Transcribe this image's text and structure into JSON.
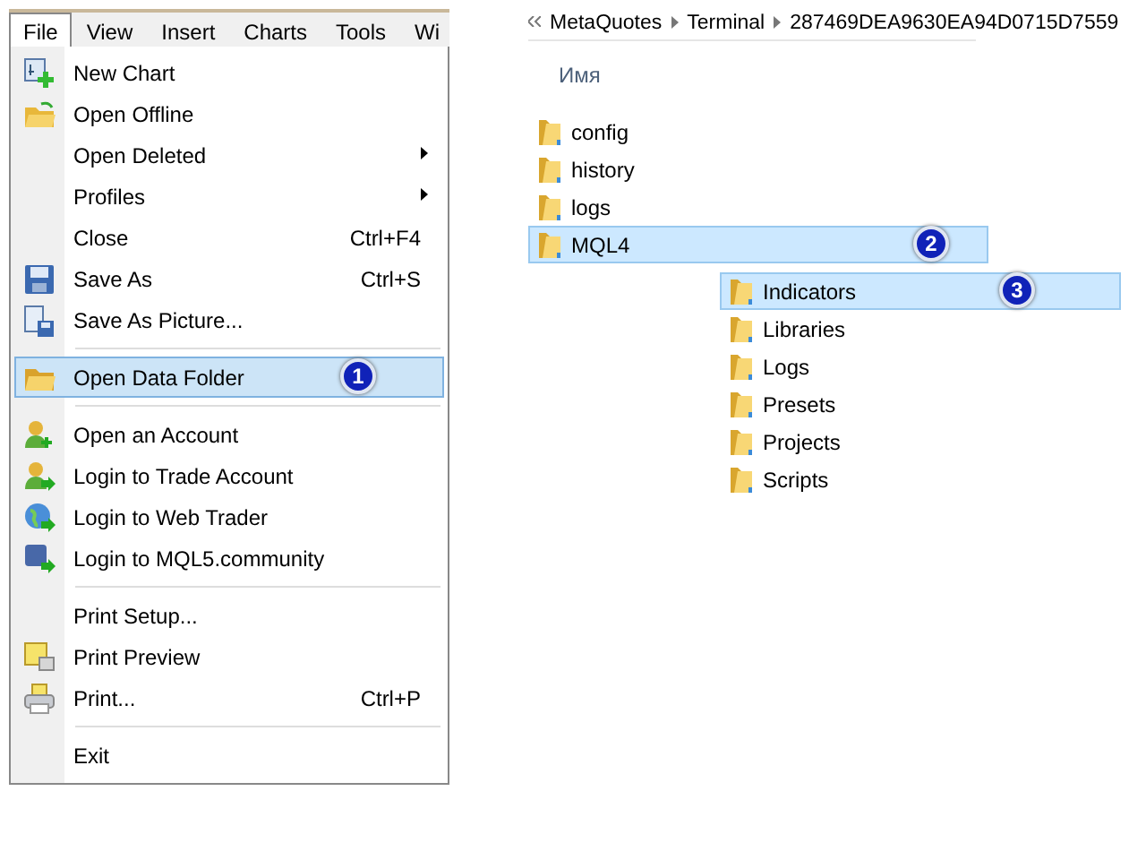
{
  "menu_bar": [
    {
      "label": "File",
      "selected": true
    },
    {
      "label": "View",
      "selected": false
    },
    {
      "label": "Insert",
      "selected": false
    },
    {
      "label": "Charts",
      "selected": false
    },
    {
      "label": "Tools",
      "selected": false
    },
    {
      "label": "Wi",
      "selected": false
    }
  ],
  "file_menu": [
    {
      "kind": "item",
      "label": "New Chart",
      "selected": false
    },
    {
      "kind": "item",
      "label": "Open Offline",
      "selected": false
    },
    {
      "kind": "item",
      "label": "Open Deleted",
      "submenu": true,
      "selected": false
    },
    {
      "kind": "item",
      "label": "Profiles",
      "submenu": true,
      "selected": false
    },
    {
      "kind": "item",
      "label": "Close",
      "shortcut": "Ctrl+F4",
      "selected": false
    },
    {
      "kind": "item",
      "label": "Save As",
      "shortcut": "Ctrl+S",
      "selected": false
    },
    {
      "kind": "item",
      "label": "Save As Picture...",
      "selected": false
    },
    {
      "kind": "separator"
    },
    {
      "kind": "item",
      "label": "Open Data Folder",
      "selected": true,
      "badge": "1"
    },
    {
      "kind": "separator"
    },
    {
      "kind": "item",
      "label": "Open an Account",
      "selected": false
    },
    {
      "kind": "item",
      "label": "Login to Trade Account",
      "selected": false
    },
    {
      "kind": "item",
      "label": "Login to Web Trader",
      "selected": false
    },
    {
      "kind": "item",
      "label": "Login to MQL5.community",
      "selected": false
    },
    {
      "kind": "separator"
    },
    {
      "kind": "item",
      "label": "Print Setup...",
      "selected": false
    },
    {
      "kind": "item",
      "label": "Print Preview",
      "selected": false
    },
    {
      "kind": "item",
      "label": "Print...",
      "shortcut": "Ctrl+P",
      "selected": false
    },
    {
      "kind": "separator"
    },
    {
      "kind": "item",
      "label": "Exit",
      "selected": false
    }
  ],
  "breadcrumb": [
    "MetaQuotes",
    "Terminal",
    "287469DEA9630EA94D0715D7559"
  ],
  "column_header": "Имя",
  "folders": [
    {
      "name": "config",
      "selected": false
    },
    {
      "name": "history",
      "selected": false
    },
    {
      "name": "logs",
      "selected": false
    },
    {
      "name": "MQL4",
      "selected": true,
      "badge": "2",
      "children": [
        {
          "name": "Indicators",
          "selected": true,
          "badge": "3"
        },
        {
          "name": "Libraries",
          "selected": false
        },
        {
          "name": "Logs",
          "selected": false
        },
        {
          "name": "Presets",
          "selected": false
        },
        {
          "name": "Projects",
          "selected": false
        },
        {
          "name": "Scripts",
          "selected": false
        }
      ]
    }
  ]
}
